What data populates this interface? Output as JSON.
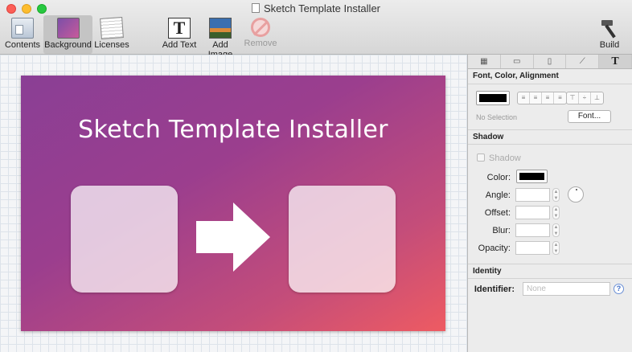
{
  "window": {
    "title": "Sketch Template Installer"
  },
  "toolbar": {
    "contents": "Contents",
    "background": "Background",
    "licenses": "Licenses",
    "add_text": "Add Text",
    "add_text_glyph": "T",
    "add_image": "Add Image",
    "remove": "Remove",
    "build": "Build",
    "selected": "Background"
  },
  "canvas": {
    "title": "Sketch Template Installer",
    "gradient_start": "#8a3f95",
    "gradient_end": "#ee5b62"
  },
  "inspector": {
    "tabs": [
      "▦",
      "▭",
      "▯",
      "⟋",
      "T"
    ],
    "active_tab": "T",
    "font_section": {
      "header": "Font, Color, Alignment",
      "text_color": "#000000",
      "no_selection": "No Selection",
      "font_button": "Font...",
      "align_options": [
        "left",
        "center",
        "right",
        "justify"
      ],
      "vertical_options": [
        "top",
        "middle",
        "bottom"
      ]
    },
    "shadow_section": {
      "header": "Shadow",
      "checkbox_label": "Shadow",
      "checked": false,
      "color_label": "Color:",
      "color": "#000000",
      "angle_label": "Angle:",
      "offset_label": "Offset:",
      "blur_label": "Blur:",
      "opacity_label": "Opacity:"
    },
    "identity_section": {
      "header": "Identity",
      "identifier_label": "Identifier:",
      "identifier_placeholder": "None",
      "help": "?"
    }
  }
}
